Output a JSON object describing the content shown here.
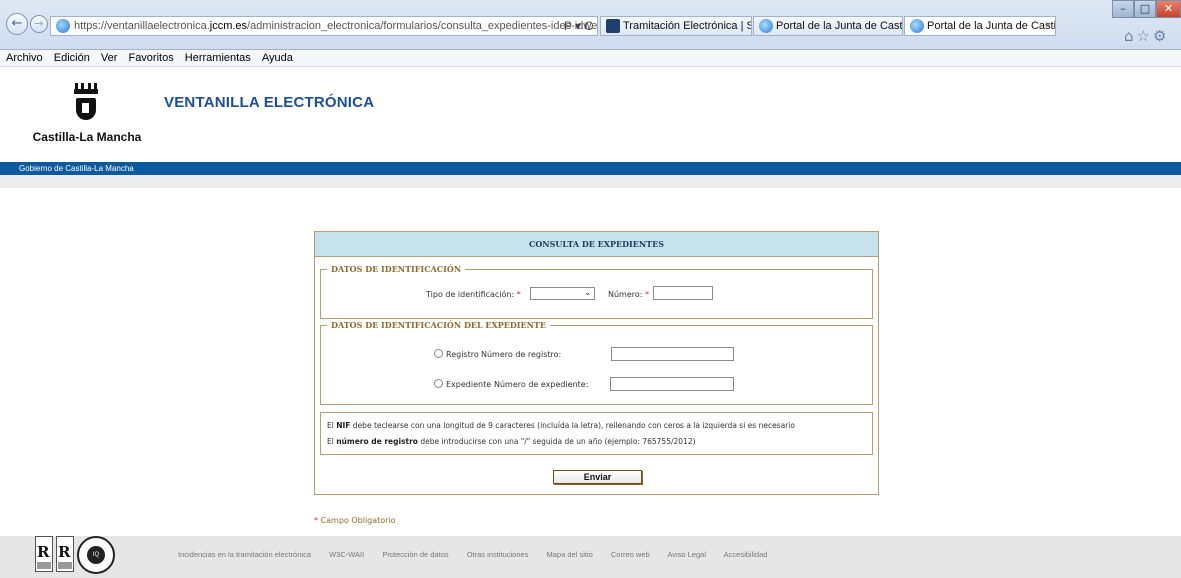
{
  "browser": {
    "address_host_prefix": "https://ventanillaelectronica.",
    "address_host": "jccm.es",
    "address_path": "/administracion_electronica/formularios/consulta_expedientes-ides-idweb.pht",
    "address_tools": "Ρ ▾ C",
    "tabs": [
      {
        "label": "Tramitación Electrónica | Sede...",
        "icon": "sede-icon"
      },
      {
        "label": "Portal de la Junta de Castilla la...",
        "icon": "ie-icon"
      },
      {
        "label": "Portal de la Junta de Castill...",
        "icon": "ie-icon",
        "close": "×"
      }
    ],
    "menu": [
      "Archivo",
      "Edición",
      "Ver",
      "Favoritos",
      "Herramientas",
      "Ayuda"
    ]
  },
  "header": {
    "logo_text": "Castilla-La Mancha",
    "title": "VENTANILLA ELECTRÓNICA",
    "gov_bar": "Gobierno de Castilla-La Mancha"
  },
  "form": {
    "title": "CONSULTA DE EXPEDIENTES",
    "section1": {
      "legend": "DATOS DE IDENTIFICACIÓN",
      "tipo_label": "Tipo de identificación:",
      "numero_label": "Número:",
      "required_mark": "*"
    },
    "section2": {
      "legend": "DATOS DE IDENTIFICACIÓN DEL EXPEDIENTE",
      "radio_registro": "Registro",
      "label_num_registro": "Número de registro:",
      "radio_expediente": "Expediente",
      "label_num_expediente": "Número de expediente:"
    },
    "notes": {
      "line1_pre": "El ",
      "line1_bold": "NIF",
      "line1_post": " debe teclearse con una longitud de 9 caracteres (incluída la letra), rellenando con ceros a la izquierda si es necesario",
      "line2_pre": "El ",
      "line2_bold": "número de registro",
      "line2_post": " debe introducirse con una \"/\" seguida de un año (ejemplo: 765755/2012)"
    },
    "submit": "Enviar",
    "required_note_mark": "*",
    "required_note": " Campo Obligatorio"
  },
  "footer": {
    "links": [
      "Incidencias en la tramitación electrónica",
      "W3C-WAII",
      "Protección de datos",
      "Otras instituciones",
      "Mapa del sitio",
      "Correo web",
      "Aviso Legal",
      "Accesibilidad"
    ]
  }
}
